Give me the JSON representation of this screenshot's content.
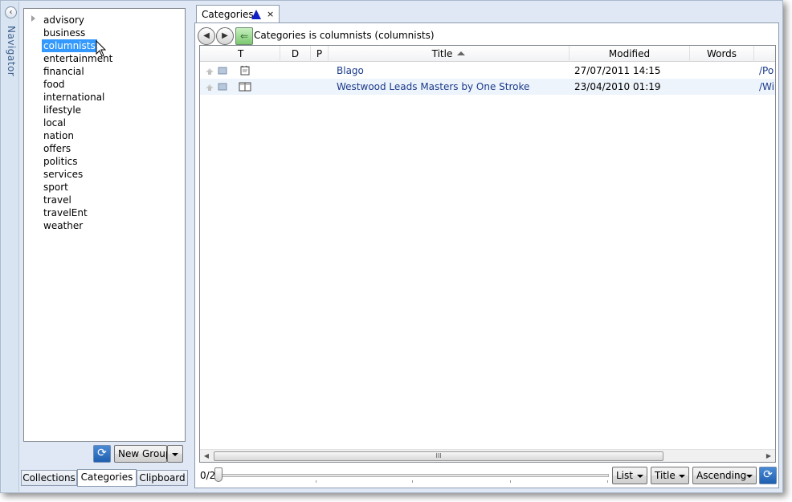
{
  "navigator": {
    "label": "Navigator",
    "collapse_glyph": "‹"
  },
  "tree": {
    "items": [
      {
        "label": "advisory",
        "expandable": true
      },
      {
        "label": "business"
      },
      {
        "label": "columnists",
        "selected": true
      },
      {
        "label": "entertainment"
      },
      {
        "label": "financial"
      },
      {
        "label": "food"
      },
      {
        "label": "international"
      },
      {
        "label": "lifestyle"
      },
      {
        "label": "local"
      },
      {
        "label": "nation"
      },
      {
        "label": "offers"
      },
      {
        "label": "politics"
      },
      {
        "label": "services"
      },
      {
        "label": "sport"
      },
      {
        "label": "travel"
      },
      {
        "label": "travelEnt"
      },
      {
        "label": "weather"
      }
    ]
  },
  "left_toolbar": {
    "refresh_glyph": "⟳",
    "new_group_label": "New Group"
  },
  "left_tabs": [
    "Collections",
    "Categories",
    "Clipboard"
  ],
  "doc_tab": {
    "label": "Categories",
    "close_glyph": "×"
  },
  "nav": {
    "back_glyph": "◀",
    "forward_glyph": "▶",
    "home_glyph": "⇐",
    "breadcrumb": "Categories is columnists (columnists)"
  },
  "grid": {
    "columns": [
      "T",
      "D",
      "P",
      "Title",
      "Modified",
      "Words"
    ],
    "rows": [
      {
        "title": "Blago",
        "modified": "27/07/2011 14:15",
        "path": "/Po"
      },
      {
        "title": "Westwood Leads Masters by One Stroke",
        "modified": "23/04/2010 01:19",
        "path": "/Wi"
      }
    ],
    "scroll_grip": "III",
    "scroll_left": "◀",
    "scroll_right": "▶"
  },
  "bottom_bar": {
    "pager": "0/2",
    "view": "List",
    "sort_field": "Title",
    "sort_order": "Ascending",
    "refresh_glyph": "⟳"
  },
  "colors": {
    "selection": "#3399ff",
    "title_link": "#1a3a8a",
    "sort_triangle": "#1020c8"
  }
}
